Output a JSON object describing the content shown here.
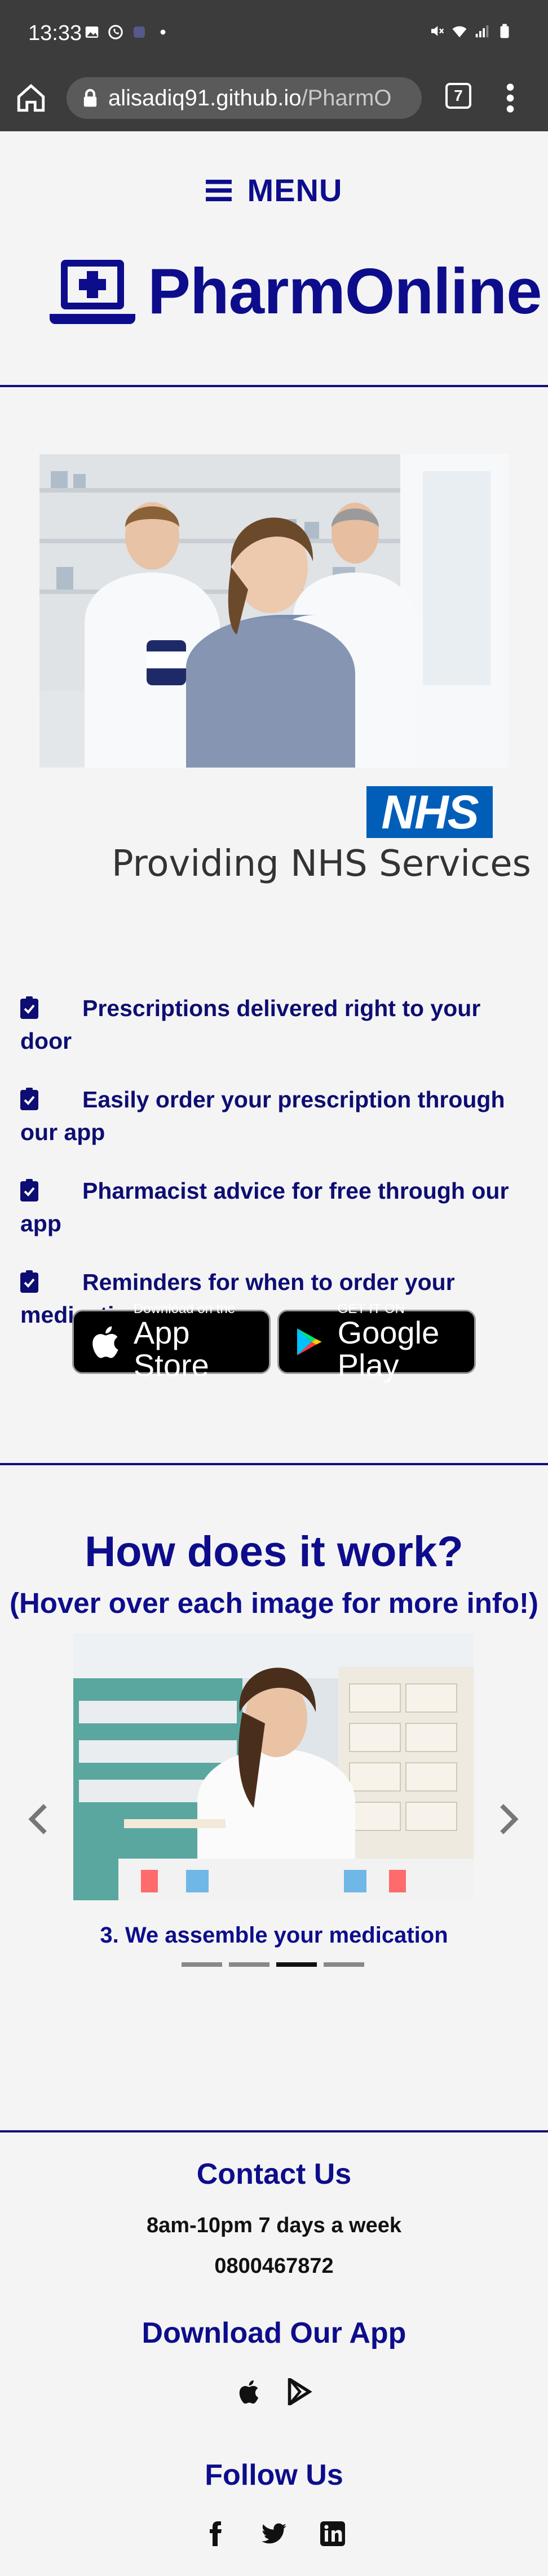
{
  "status_bar": {
    "time": "13:33",
    "left_icons": [
      "image-icon",
      "whatsapp-icon",
      "app-icon",
      "dot-icon"
    ],
    "right_icons": [
      "mute-icon",
      "wifi-icon",
      "signal-icon",
      "battery-icon"
    ]
  },
  "browser": {
    "url_host": "alisadiq91.github.io",
    "url_path": "/PharmO",
    "tab_count": "7"
  },
  "header": {
    "menu_label": "MENU",
    "brand_name": "PharmOnline"
  },
  "hero": {
    "nhs_logo_text": "NHS",
    "nhs_caption": "Providing NHS Services"
  },
  "features": [
    {
      "text": "Prescriptions delivered right to your door"
    },
    {
      "text": "Easily order your prescription through our app"
    },
    {
      "text": "Pharmacist advice for free through our app"
    },
    {
      "text": "Reminders for when to order your medication"
    }
  ],
  "app_badges": {
    "apple_small": "Download on the",
    "apple_big": "App Store",
    "google_small": "GET IT ON",
    "google_big": "Google Play"
  },
  "how_it_works": {
    "title": "How does it work?",
    "subtitle": "(Hover over each image for more info!)",
    "caption": "3. We assemble your medication",
    "slide_count": 4,
    "active_slide": 3
  },
  "footer": {
    "contact_title": "Contact Us",
    "hours": "8am-10pm 7 days a week",
    "phone": "0800467872",
    "download_title": "Download Our App",
    "follow_title": "Follow Us"
  },
  "colors": {
    "brand_navy": "#0d0d8c",
    "nhs_blue": "#005eb8",
    "browser_chrome": "#3c3c3c"
  }
}
